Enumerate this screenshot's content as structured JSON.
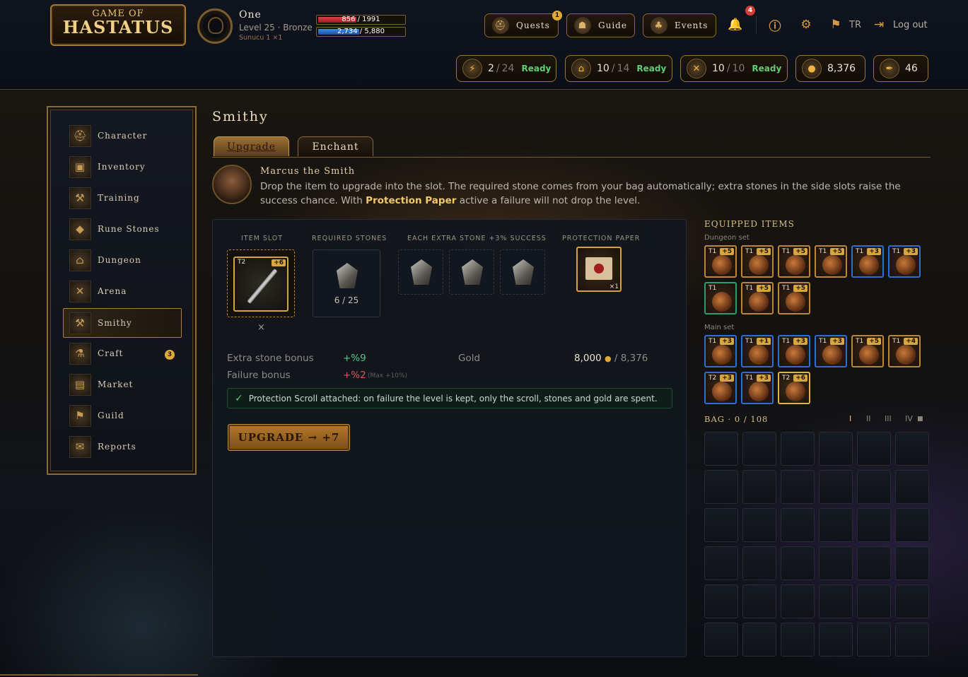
{
  "colors": {
    "accent": "#c9973f",
    "ready": "#5fcf73",
    "bonus_positive": "#4ecb8a",
    "bonus_negative": "#e0545e",
    "rare_border": "#2e6ed0",
    "legendary_border": "#d6a33c",
    "uncommon_border": "#2e9b6a"
  },
  "logo": {
    "line1": "GAME OF",
    "line2": "HASTATUS"
  },
  "player": {
    "name": "One",
    "level_line": "Level 25 · Bronze",
    "server": "Sunucu 1 ×1",
    "hp": {
      "text": "856 / 1991",
      "fraction": 0.43
    },
    "xp": {
      "text": "2,734 / 5,880",
      "fraction": 0.46
    }
  },
  "topnav": {
    "quests": "Quests",
    "quests_badge": "1",
    "guide": "Guide",
    "events": "Events",
    "notif_badge": "4",
    "lang": "TR",
    "logout": "Log out"
  },
  "resources": [
    {
      "icon": "lightning-icon",
      "value": "2",
      "max": "24",
      "ready": "Ready"
    },
    {
      "icon": "door-icon",
      "value": "10",
      "max": "14",
      "ready": "Ready"
    },
    {
      "icon": "swords-icon",
      "value": "10",
      "max": "10",
      "ready": "Ready"
    },
    {
      "icon": "coin-icon",
      "value": "8,376"
    },
    {
      "icon": "feather-icon",
      "value": "46"
    }
  ],
  "sidebar": {
    "items": [
      {
        "label": "Character",
        "icon": "helmet-icon"
      },
      {
        "label": "Inventory",
        "icon": "chest-icon"
      },
      {
        "label": "Training",
        "icon": "dumbbell-icon"
      },
      {
        "label": "Rune Stones",
        "icon": "rune-icon"
      },
      {
        "label": "Dungeon",
        "icon": "dungeon-icon"
      },
      {
        "label": "Arena",
        "icon": "crossed-swords-icon"
      },
      {
        "label": "Smithy",
        "icon": "hammer-icon"
      },
      {
        "label": "Craft",
        "icon": "mortar-icon",
        "badge": "3"
      },
      {
        "label": "Market",
        "icon": "market-icon"
      },
      {
        "label": "Guild",
        "icon": "banner-icon"
      },
      {
        "label": "Reports",
        "icon": "scroll-icon"
      }
    ]
  },
  "page": {
    "title": "Smithy",
    "tabs": [
      "Upgrade",
      "Enchant"
    ]
  },
  "npc": {
    "name": "Marcus the Smith",
    "desc_1": "Drop the item to upgrade into the slot. The required stone comes from your bag automatically; extra stones in the side slots raise the success chance. With ",
    "desc_highlight": "Protection Paper",
    "desc_2": " active a failure will not drop the level."
  },
  "upgrade": {
    "item_slot_label": "ITEM SLOT",
    "required_label": "REQUIRED STONES",
    "extra_label": "EACH EXTRA STONE +3% SUCCESS",
    "protection_label": "PROTECTION PAPER",
    "item": {
      "tier": "T2",
      "plus": "+6"
    },
    "remove": "×",
    "stones": "6 / 25",
    "paper_count": "×1",
    "extra_bonus_label": "Extra stone bonus",
    "extra_bonus": "+%9",
    "failure_bonus_label": "Failure bonus",
    "failure_bonus": "+%2",
    "failure_max": "(Max +10%)",
    "gold_label": "Gold",
    "gold_cost": "8,000",
    "gold_have": "/ 8,376",
    "notice": "Protection Scroll attached: on failure the level is kept, only the scroll, stones and gold are spent.",
    "button": "UPGRADE → +7"
  },
  "equipped": {
    "title": "EQUIPPED ITEMS",
    "dungeon_label": "Dungeon set",
    "dungeon": [
      {
        "t": "T1",
        "p": "+5",
        "rarity": "legendary"
      },
      {
        "t": "T1",
        "p": "+5",
        "rarity": "legendary"
      },
      {
        "t": "T1",
        "p": "+5",
        "rarity": "legendary"
      },
      {
        "t": "T1",
        "p": "+5",
        "rarity": "legendary"
      },
      {
        "t": "T1",
        "p": "+3",
        "rarity": "rare"
      },
      {
        "t": "T1",
        "p": "+3",
        "rarity": "rare"
      },
      {
        "t": "T1",
        "p": "",
        "rarity": "uncommon"
      },
      {
        "t": "T1",
        "p": "+5",
        "rarity": "legendary"
      },
      {
        "t": "T1",
        "p": "+5",
        "rarity": "legendary"
      }
    ],
    "main_label": "Main set",
    "main": [
      {
        "t": "T1",
        "p": "+3",
        "rarity": "rare"
      },
      {
        "t": "T1",
        "p": "+1",
        "rarity": "rare"
      },
      {
        "t": "T1",
        "p": "+3",
        "rarity": "rare"
      },
      {
        "t": "T1",
        "p": "+3",
        "rarity": "rare"
      },
      {
        "t": "T1",
        "p": "+5",
        "rarity": "legendary"
      },
      {
        "t": "T1",
        "p": "+4",
        "rarity": "legendary"
      },
      {
        "t": "T2",
        "p": "+3",
        "rarity": "rare"
      },
      {
        "t": "T1",
        "p": "+3",
        "rarity": "rare"
      },
      {
        "t": "T2",
        "p": "+6",
        "rarity": "selected"
      }
    ]
  },
  "bag": {
    "title": "BAG · 0 / 108",
    "pages": [
      "I",
      "II",
      "III",
      "IV"
    ],
    "locked_page_icon": "lock-icon"
  }
}
